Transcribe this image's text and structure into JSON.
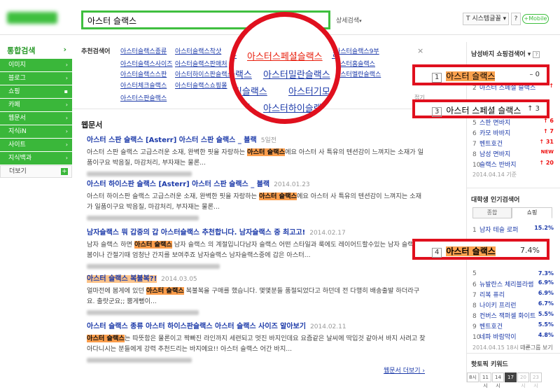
{
  "header": {
    "search_value": "아스터 슬랙스",
    "detail_search": "상세검색",
    "detail_arrow": "▾",
    "font_button": "T 시스템글꼴 ▾",
    "help": "?",
    "mobile": "+Mobile"
  },
  "leftnav": {
    "title": "통합검색",
    "title_arrow": "›",
    "items": [
      "이미지",
      "블로그",
      "쇼핑",
      "카페",
      "웹문서",
      "지식iN",
      "사이트",
      "지식백과"
    ],
    "more": "더보기",
    "more_icon": "+"
  },
  "suggest": {
    "label": "추천검색어",
    "close": "×",
    "more": "접기",
    "keywords": [
      "아스터슬랙스종류",
      "아스터슬랙스착샷",
      "아스터슬랙스사이즈",
      "아스터슬랙스판매처",
      "아스터슬랙스스판",
      "아스터하이스판슬랙스",
      "아스터체크슬랙스",
      "아스터슬랙스쇼핑몰",
      "아스터스판슬랙스",
      "아스터슬랙스9부",
      "아스터홈슬랙스",
      "아스터멜란슬랙스"
    ]
  },
  "magnifier": {
    "row1": [
      "아스터스페셜슬랙스"
    ],
    "row2": [
      "터슬랙스",
      "아스터밀란슬랙스"
    ],
    "row3": [
      "터슬림슬랙스",
      "아스터기모슬"
    ],
    "row4": [
      "바지",
      "아스터하이슬랙스"
    ],
    "frag1": "부",
    "frag2": "ㄹ"
  },
  "results": {
    "section": "웹문서",
    "more_link": "웹문서 더보기 ›",
    "items": [
      {
        "title": "아스터 스판 슬랙스 [Asterr] 아스터 스판 슬랙스 _ 블랙",
        "date": "5일전",
        "body1": "아스터 스판 슬랙스 고급스러운 소재, 완벽한 핏을 자랑하는 ",
        "hl1": "아스터 슬랙스",
        "body2": "에요 아스터 사 특유의 텐션감이 느껴지는 소재가 일품이구요 박음질, 마감처리, 부자재는 물론..."
      },
      {
        "title": "아스터 하이스판 슬랙스 [Asterr] 아스터 스판 슬랙스 _ 블랙",
        "date": "2014.01.23",
        "body1": "아스터 하이스판 슬랙스 고급스러운 소재, 완벽한 핏을 자랑하는 ",
        "hl1": "아스터 슬랙스",
        "body2": "에요 아스터 사 특유의 텐션감이 느껴지는 소재가 일품이구요 박음질, 마감처리, 부자재는 물론..."
      },
      {
        "title": "남자슬랙스 뭐 갑중의 갑 아스터슬랙스 추천합니다. 남자슬랙스 중 최고고!",
        "date": "2014.02.17",
        "body1": "남자 슬랙스 하면 ",
        "hl1": "아스터 슬랙스",
        "body2": " 남자 슬랙스 의 계절입니다남자 슬랙스 어떤 스타일과 룩에도 레이어드할수있는 남자 슬랙스 봄이나 간절기때 엄청난 간지를 보여주죠 남자슬랙스 남자슬랙스중에 갑은 아스터..."
      },
      {
        "title": "아스터 슬랙스 복불복?!",
        "date": "2014.03.05",
        "body1": "얼마전에 봄게에 있던 ",
        "hl1": "아스터 슬랙스",
        "body2": " 복불복을 구매를 했습니다. 몇몇분들 품절되었다고 하던데 전 다행히 배송출발 하더라구요. 출랏군요;; 뿜게뻥이..."
      },
      {
        "title": "아스터 슬랙스 종류 아스터 하이스판슬랙스 아스터 슬랙스 사이즈 알아보기",
        "date": "2014.02.11",
        "body1": "",
        "hl1": "아스터 슬랙스",
        "body2": "는 따뜻함은 물론이고 짝빠진 라인까지 세련되고 멋진 바지인데요 요즘같은 날씨에 딱입것 같아서 바지 사려고 찾아다니시는 분들에게 강력 추천드리는 바지에요!! 아스터 슬랙스 어간 바지..."
      }
    ]
  },
  "rightcol": {
    "shop_title": "남성바지 쇼핑검색어 ▾",
    "help": "?",
    "shop_ranks": [
      {
        "n": "1",
        "t": "아스터 슬랙스",
        "c": "-"
      },
      {
        "n": "2",
        "t": "아스터 스페셜 슬랙스",
        "c": "↑"
      },
      {
        "n": "3",
        "t": "아스터 스페셜 슬랙스",
        "c": "↑"
      },
      {
        "n": "4",
        "t": "기모 바지",
        "c": "↑"
      },
      {
        "n": "5",
        "t": "스판 면바지",
        "c": "↑ 6"
      },
      {
        "n": "6",
        "t": "카모 바바지",
        "c": "↑ 7"
      },
      {
        "n": "7",
        "t": "벤트호건",
        "c": "↑ 31"
      },
      {
        "n": "8",
        "t": "남성 면바지",
        "c": "NEW"
      },
      {
        "n": "10",
        "t": "슬랙스 반바지",
        "c": "↑ 20"
      }
    ],
    "shop_date": "2014.04.14 기준",
    "uni_title": "대학생 인기검색어",
    "tab1": "종합",
    "tab2": "쇼핑",
    "uni_ranks": [
      {
        "n": "1",
        "t": "남자 테슬 로퍼",
        "c": "15.2%"
      },
      {
        "n": "2",
        "t": "",
        "c": ""
      },
      {
        "n": "3",
        "t": "",
        "c": ""
      },
      {
        "n": "4",
        "t": "아스터 슬랙스",
        "c": "7.4%"
      },
      {
        "n": "5",
        "t": "",
        "c": "7.3%"
      },
      {
        "n": "6",
        "t": "뉴발란스 체리블라썸",
        "c": "6.9%"
      },
      {
        "n": "7",
        "t": "리복 퓨리",
        "c": "6.9%"
      },
      {
        "n": "8",
        "t": "나이키 프리런",
        "c": "6.7%"
      },
      {
        "n": "8",
        "t": "컨버스 잭퍼셀 화이트",
        "c": "5.5%"
      },
      {
        "n": "9",
        "t": "벤트호건",
        "c": "5.5%"
      },
      {
        "n": "10",
        "t": "네파 바람막이",
        "c": "4.8%"
      }
    ],
    "uni_date": "2014.04.15 18시 기준",
    "uni_nav": "다른그룹 보기",
    "hot_title": "핫토픽 키워드",
    "hours": [
      "8시",
      "11시",
      "14시",
      "17시",
      "20시",
      "23시"
    ]
  },
  "callouts": {
    "c1": {
      "num": "1",
      "text": "아스터 슬랙스",
      "right": "–  0"
    },
    "c2": {
      "num": "3",
      "text": "아스터 스페셜 슬랙스",
      "right": "↑ 3"
    },
    "c3": {
      "num": "4",
      "text": "아스터 슬랙스",
      "right": "7.4%"
    }
  }
}
